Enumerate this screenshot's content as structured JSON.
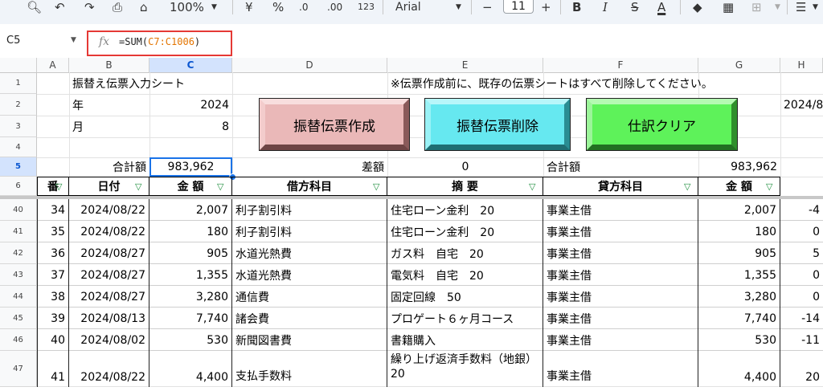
{
  "toolbar": {
    "zoom": "100%",
    "currency": "¥",
    "percent": "%",
    "dec_less": ".0",
    "dec_more": ".00",
    "format_123": "123",
    "font": "Arial",
    "font_size": "11",
    "minus": "−",
    "plus": "+",
    "bold": "B",
    "italic": "I",
    "strike": "S",
    "text_color": "A"
  },
  "formula_bar": {
    "cell_ref": "C5",
    "formula_prefix": "=SUM(",
    "formula_ref": "C7:C1006",
    "formula_suffix": ")"
  },
  "columns": [
    "A",
    "B",
    "C",
    "D",
    "E",
    "F",
    "G",
    "H"
  ],
  "top_rows": [
    {
      "num": "1",
      "b": "振替え伝票入力シート",
      "e": "※伝票作成前に、既存の伝票シートはすべて削除してください。"
    },
    {
      "num": "2",
      "b": "年",
      "c": "2024",
      "h": "2024/8"
    },
    {
      "num": "3",
      "b": "月",
      "c": "8"
    },
    {
      "num": "4"
    },
    {
      "num": "5",
      "b": "合計額",
      "c": "983,962",
      "d": "差額",
      "e": "0",
      "f": "合計額",
      "g": "983,962"
    }
  ],
  "buttons": {
    "create": "振替伝票作成",
    "delete": "振替伝票削除",
    "clear": "仕訳クリア"
  },
  "header_row": {
    "num": "6",
    "a": "番",
    "b": "日付",
    "c": "金 額",
    "d": "借方科目",
    "e": "摘 要",
    "f": "貸方科目",
    "g": "金 額"
  },
  "rows": [
    {
      "num": "40",
      "a": "34",
      "b": "2024/08/22",
      "c": "2,007",
      "d": "利子割引料",
      "e": "住宅ローン金利　20",
      "f": "事業主借",
      "g": "2,007",
      "h": "-4"
    },
    {
      "num": "41",
      "a": "35",
      "b": "2024/08/22",
      "c": "180",
      "d": "利子割引料",
      "e": "住宅ローン金利　20",
      "f": "事業主借",
      "g": "180",
      "h": "0"
    },
    {
      "num": "42",
      "a": "36",
      "b": "2024/08/27",
      "c": "905",
      "d": "水道光熱費",
      "e": "ガス料　自宅　20",
      "f": "事業主借",
      "g": "905",
      "h": "5"
    },
    {
      "num": "43",
      "a": "37",
      "b": "2024/08/27",
      "c": "1,355",
      "d": "水道光熱費",
      "e": "電気料　自宅　20",
      "f": "事業主借",
      "g": "1,355",
      "h": "0"
    },
    {
      "num": "44",
      "a": "38",
      "b": "2024/08/27",
      "c": "3,280",
      "d": "通信費",
      "e": "固定回線　50",
      "f": "事業主借",
      "g": "3,280",
      "h": "0"
    },
    {
      "num": "45",
      "a": "39",
      "b": "2024/08/13",
      "c": "7,740",
      "d": "諸会費",
      "e": "プロゲート６ヶ月コース",
      "f": "事業主借",
      "g": "7,740",
      "h": "-14"
    },
    {
      "num": "46",
      "a": "40",
      "b": "2024/08/02",
      "c": "530",
      "d": "新聞図書費",
      "e": "書籍購入",
      "f": "事業主借",
      "g": "530",
      "h": "-11"
    },
    {
      "num": "47",
      "a": "41",
      "b": "2024/08/22",
      "c": "4,400",
      "d": "支払手数料",
      "e": "繰り上げ返済手数料（地銀）20",
      "f": "事業主借",
      "g": "4,400",
      "h": "20"
    }
  ]
}
